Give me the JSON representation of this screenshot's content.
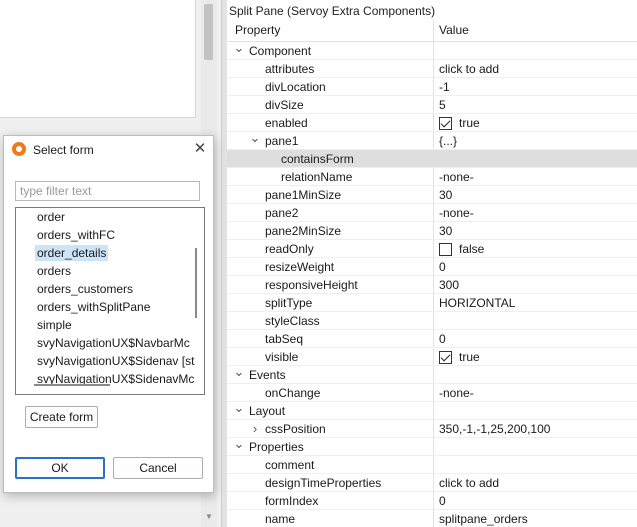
{
  "properties_panel": {
    "title": "Split Pane (Servoy Extra Components)",
    "header": {
      "property": "Property",
      "value": "Value"
    },
    "rows": [
      {
        "name": "Component",
        "value": "",
        "level": 0,
        "twisty": "open"
      },
      {
        "name": "attributes",
        "value": "click to add",
        "level": 2
      },
      {
        "name": "divLocation",
        "value": "-1",
        "level": 2
      },
      {
        "name": "divSize",
        "value": "5",
        "level": 2
      },
      {
        "name": "enabled",
        "value": "true",
        "level": 2,
        "checkbox": true
      },
      {
        "name": "pane1",
        "value": "{...}",
        "level": 1,
        "twisty": "open"
      },
      {
        "name": "containsForm",
        "value": "",
        "level": 3,
        "selected": true
      },
      {
        "name": "relationName",
        "value": "-none-",
        "level": 3
      },
      {
        "name": "pane1MinSize",
        "value": "30",
        "level": 2
      },
      {
        "name": "pane2",
        "value": "-none-",
        "level": 2
      },
      {
        "name": "pane2MinSize",
        "value": "30",
        "level": 2
      },
      {
        "name": "readOnly",
        "value": "false",
        "level": 2,
        "checkbox": false
      },
      {
        "name": "resizeWeight",
        "value": "0",
        "level": 2
      },
      {
        "name": "responsiveHeight",
        "value": "300",
        "level": 2
      },
      {
        "name": "splitType",
        "value": "HORIZONTAL",
        "level": 2
      },
      {
        "name": "styleClass",
        "value": "",
        "level": 2
      },
      {
        "name": "tabSeq",
        "value": "0",
        "level": 2
      },
      {
        "name": "visible",
        "value": "true",
        "level": 2,
        "checkbox": true
      },
      {
        "name": "Events",
        "value": "",
        "level": 0,
        "twisty": "open"
      },
      {
        "name": "onChange",
        "value": "-none-",
        "level": 2
      },
      {
        "name": "Layout",
        "value": "",
        "level": 0,
        "twisty": "open"
      },
      {
        "name": "cssPosition",
        "value": "350,-1,-1,25,200,100",
        "level": 1,
        "twisty": "closed"
      },
      {
        "name": "Properties",
        "value": "",
        "level": 0,
        "twisty": "open"
      },
      {
        "name": "comment",
        "value": "",
        "level": 2
      },
      {
        "name": "designTimeProperties",
        "value": "click to add",
        "level": 2
      },
      {
        "name": "formIndex",
        "value": "0",
        "level": 2
      },
      {
        "name": "name",
        "value": "splitpane_orders",
        "level": 2
      }
    ]
  },
  "dialog": {
    "title": "Select form",
    "filter_placeholder": "type filter text",
    "filter_value": "",
    "forms": [
      "order",
      "orders_withFC",
      "order_details",
      "orders",
      "orders_customers",
      "orders_withSplitPane",
      "simple",
      "svyNavigationUX$NavbarMc",
      "svyNavigationUX$Sidenav [st",
      "svyNavigationUX$SidenavMc"
    ],
    "selected_form": "order_details",
    "create_label": "Create form",
    "ok_label": "OK",
    "cancel_label": "Cancel"
  }
}
